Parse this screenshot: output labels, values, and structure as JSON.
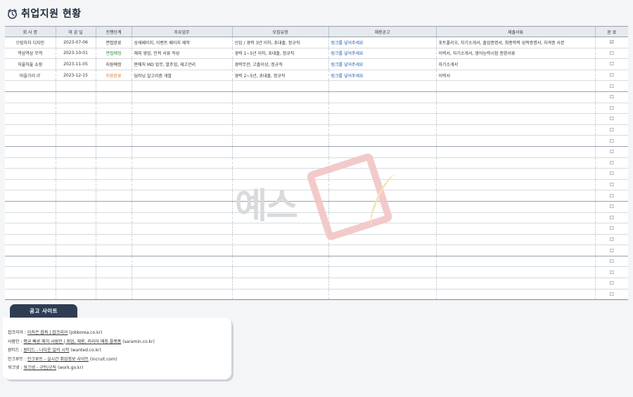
{
  "title": "취업지원 현황",
  "columns": [
    "회 사 명",
    "마 감 일",
    "진행단계",
    "주요업무",
    "모집유형",
    "채용공고",
    "제출서류",
    "완 료"
  ],
  "rows": [
    {
      "company": "으랏차차 디자인",
      "deadline": "2023-07-06",
      "stage": "면접완료",
      "stage_color": "#333333",
      "duties": "상세페이지, 이벤트 페이지 제작",
      "type": "신입 / 경력 3년 이하, 초대졸, 정규직",
      "posting": "링크를 넣어주세요",
      "documents": "포트폴리오, 자기소개서, 졸업증명서, 최종학력 성적증명서, 자격증 사본",
      "done": "☑"
    },
    {
      "company": "역삼역삼 무역",
      "deadline": "2023-10-01",
      "stage": "면접예정",
      "stage_color": "#2e8b3a",
      "duties": "해외 영업, 인적 서류 작성",
      "type": "경력 1~5년 이하, 초대졸, 정규직",
      "posting": "링크를 넣어주세요",
      "documents": "이력서, 자기소개서, 영어능력시험 증명서류",
      "done": "☐"
    },
    {
      "company": "하울하울 쇼핑",
      "deadline": "2023-11-05",
      "stage": "지원예정",
      "stage_color": "#333333",
      "duties": "판매처 MD 업무, 발주업, 재고관리",
      "type": "경력무관, 고졸이상, 정규직",
      "posting": "링크를 넣어주세요",
      "documents": "자기소개서",
      "done": "☐"
    },
    {
      "company": "마을가리 IT",
      "deadline": "2023-12-15",
      "stage": "지원완료",
      "stage_color": "#e0762a",
      "duties": "딥러닝 알고리즘 개발",
      "type": "경력 2~5년, 초대졸, 정규직",
      "posting": "링크를 넣어주세요",
      "documents": "이력서",
      "done": "☐"
    }
  ],
  "empty_checkbox": "☐",
  "sites": {
    "tab_label": "공고 사이트",
    "items": [
      {
        "prefix": "잡코리아 : ",
        "text": "이직은 잡픽 | 잡코리아",
        "suffix": " (jobkorea.co.kr)"
      },
      {
        "prefix": "사람인 : ",
        "text": "평균 빠른 매치 사람인 | 취업, 채용, 커리어 매칭 플랫폼",
        "suffix": " (saramin.co.kr)"
      },
      {
        "prefix": "원티드 : ",
        "text": "원티드 - 나다운 일의 시작",
        "suffix": " (wanted.co.kr)"
      },
      {
        "prefix": "인크루트 : ",
        "text": "인크루트 - 실시간 취업정보 사이트",
        "suffix": " (incruit.com)"
      },
      {
        "prefix": "워크넷 : ",
        "text": "워크넷 - 구인/구직",
        "suffix": " (work.go.kr)"
      }
    ]
  },
  "watermark": "예스"
}
